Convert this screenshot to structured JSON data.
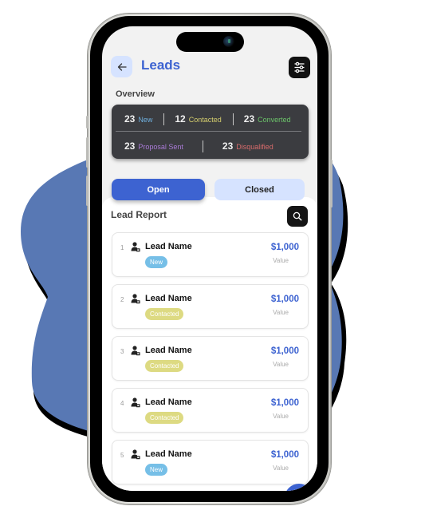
{
  "app": {
    "title": "Leads",
    "back_icon": "arrow-left-icon",
    "filter_icon": "sliders-icon"
  },
  "overview": {
    "label": "Overview",
    "stats": [
      {
        "count": "23",
        "label": "New",
        "color": "#6fb0df"
      },
      {
        "count": "12",
        "label": "Contacted",
        "color": "#d6cf6e"
      },
      {
        "count": "23",
        "label": "Converted",
        "color": "#6cc46a"
      },
      {
        "count": "23",
        "label": "Proposal Sent",
        "color": "#a97ad6"
      },
      {
        "count": "23",
        "label": "Disqualified",
        "color": "#d76b6b"
      }
    ]
  },
  "tabs": [
    {
      "label": "Open",
      "active": true
    },
    {
      "label": "Closed",
      "active": false
    }
  ],
  "report": {
    "label": "Lead Report",
    "search_icon": "search-icon"
  },
  "leads": [
    {
      "index": "1",
      "name": "Lead Name",
      "status": "New",
      "status_color": "#6fbce6",
      "value": "$1,000",
      "value_label": "Value"
    },
    {
      "index": "2",
      "name": "Lead Name",
      "status": "Contacted",
      "status_color": "#dcd97c",
      "value": "$1,000",
      "value_label": "Value"
    },
    {
      "index": "3",
      "name": "Lead Name",
      "status": "Contacted",
      "status_color": "#dcd97c",
      "value": "$1,000",
      "value_label": "Value"
    },
    {
      "index": "4",
      "name": "Lead Name",
      "status": "Contacted",
      "status_color": "#dcd97c",
      "value": "$1,000",
      "value_label": "Value"
    },
    {
      "index": "5",
      "name": "Lead Name",
      "status": "New",
      "status_color": "#6fbce6",
      "value": "$1,000",
      "value_label": "Value"
    }
  ],
  "colors": {
    "accent": "#3d63d1",
    "accent_light": "#d6e3ff",
    "blob": "#5878b4"
  }
}
